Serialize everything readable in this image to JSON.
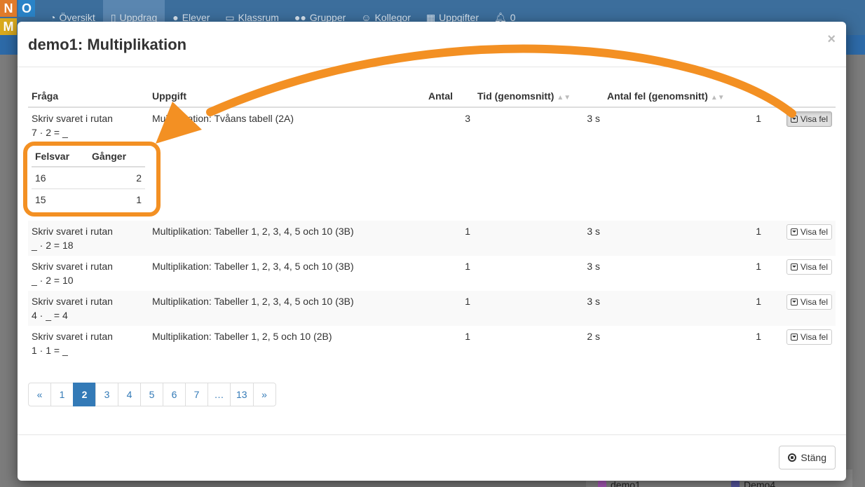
{
  "logo": {
    "letters": [
      "N",
      "O",
      "M",
      ""
    ]
  },
  "nav": {
    "items": [
      {
        "icon": "dashboard-icon",
        "label": "Översikt"
      },
      {
        "icon": "book-icon",
        "label": "Uppdrag"
      },
      {
        "icon": "user-icon",
        "label": "Elever"
      },
      {
        "icon": "monitor-icon",
        "label": "Klassrum"
      },
      {
        "icon": "users-icon",
        "label": "Grupper"
      },
      {
        "icon": "smiley-icon",
        "label": "Kollegor"
      },
      {
        "icon": "grid-icon",
        "label": "Uppgifter"
      },
      {
        "icon": "bell-icon",
        "label": "0"
      }
    ]
  },
  "background": {
    "legend": [
      {
        "label": "demo1",
        "color": "#b05cc0"
      },
      {
        "label": "Demo4",
        "color": "#5a5aa8"
      }
    ]
  },
  "modal": {
    "title": "demo1: Multiplikation",
    "close_symbol": "×",
    "columns": {
      "question": "Fråga",
      "task": "Uppgift",
      "count": "Antal",
      "time": "Tid (genomsnitt)",
      "errors": "Antal fel (genomsnitt)"
    },
    "show_errors_label": "Visa fel",
    "rows": [
      {
        "question_line1": "Skriv svaret i rutan",
        "question_line2": "7 · 2 = _",
        "task": "Multiplikation: Tvåans tabell (2A)",
        "count": "3",
        "time": "3 s",
        "errors": "1"
      },
      {
        "question_line1": "Skriv svaret i rutan",
        "question_line2": "_ · 2 = 18",
        "task": "Multiplikation: Tabeller 1, 2, 3, 4, 5 och 10 (3B)",
        "count": "1",
        "time": "3 s",
        "errors": "1"
      },
      {
        "question_line1": "Skriv svaret i rutan",
        "question_line2": "_ · 2 = 10",
        "task": "Multiplikation: Tabeller 1, 2, 3, 4, 5 och 10 (3B)",
        "count": "1",
        "time": "3 s",
        "errors": "1"
      },
      {
        "question_line1": "Skriv svaret i rutan",
        "question_line2": "4 · _ = 4",
        "task": "Multiplikation: Tabeller 1, 2, 3, 4, 5 och 10 (3B)",
        "count": "1",
        "time": "3 s",
        "errors": "1"
      },
      {
        "question_line1": "Skriv svaret i rutan",
        "question_line2": "1 · 1 = _",
        "task": "Multiplikation: Tabeller 1, 2, 5 och 10 (2B)",
        "count": "1",
        "time": "2 s",
        "errors": "1"
      }
    ],
    "wrong_answers": {
      "header_answer": "Felsvar",
      "header_times": "Gånger",
      "rows": [
        {
          "answer": "16",
          "times": "2"
        },
        {
          "answer": "15",
          "times": "1"
        }
      ]
    },
    "pagination": [
      "«",
      "1",
      "2",
      "3",
      "4",
      "5",
      "6",
      "7",
      "…",
      "13",
      "»"
    ],
    "pagination_active": "2",
    "close_button_label": "Stäng"
  },
  "colors": {
    "accent": "#337ab7",
    "highlight": "#f39023",
    "nav_bg": "#3c6e9c"
  }
}
